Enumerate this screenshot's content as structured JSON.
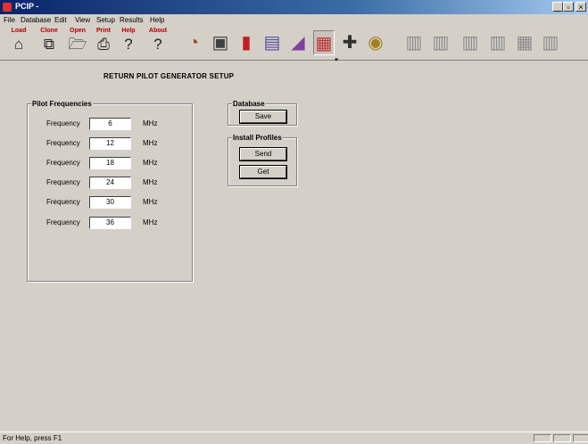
{
  "window": {
    "title": "PCIP -",
    "minimize": "_",
    "restore": "▫",
    "close": "×"
  },
  "menu": [
    "File",
    "Database",
    "Edit",
    "View",
    "Setup",
    "Results",
    "Help"
  ],
  "toolbar": {
    "labeled": [
      {
        "label": "Load",
        "icon": "⌂"
      },
      {
        "label": "Clone",
        "icon": "⧉"
      },
      {
        "label": "Open",
        "icon": "🗁"
      },
      {
        "label": "Print",
        "icon": "⎙"
      },
      {
        "label": "Help",
        "icon": "?"
      },
      {
        "label": "About",
        "icon": "?"
      }
    ],
    "tools": [
      {
        "icon": "◔",
        "color": "#b04020"
      },
      {
        "icon": "▣",
        "color": "#404040"
      },
      {
        "icon": "▮",
        "color": "#c02020"
      },
      {
        "icon": "▤",
        "color": "#5050a0"
      },
      {
        "icon": "◢",
        "color": "#8040a0"
      },
      {
        "icon": "▦",
        "color": "#c03030",
        "pressed": true
      },
      {
        "icon": "✚",
        "color": "#303030"
      },
      {
        "icon": "◉",
        "color": "#a08020"
      },
      {
        "icon": "▥",
        "color": "#8a8a8a",
        "gray": true
      },
      {
        "icon": "▥",
        "color": "#8a8a8a",
        "gray": true
      },
      {
        "icon": "▥",
        "color": "#8a8a8a",
        "gray": true
      },
      {
        "icon": "▥",
        "color": "#8a8a8a",
        "gray": true
      },
      {
        "icon": "▦",
        "color": "#8a8a8a",
        "gray": true
      },
      {
        "icon": "▥",
        "color": "#8a8a8a",
        "gray": true
      }
    ]
  },
  "page": {
    "title": "RETURN PILOT GENERATOR SETUP"
  },
  "pilot_frequencies": {
    "legend": "Pilot Frequencies",
    "row_label": "Frequency",
    "unit": "MHz",
    "values": [
      "6",
      "12",
      "18",
      "24",
      "30",
      "36"
    ]
  },
  "database": {
    "legend": "Database",
    "save_label": "Save"
  },
  "install_profiles": {
    "legend": "Install Profiles",
    "send_label": "Send",
    "get_label": "Get"
  },
  "status": {
    "text": "For Help, press F1"
  }
}
